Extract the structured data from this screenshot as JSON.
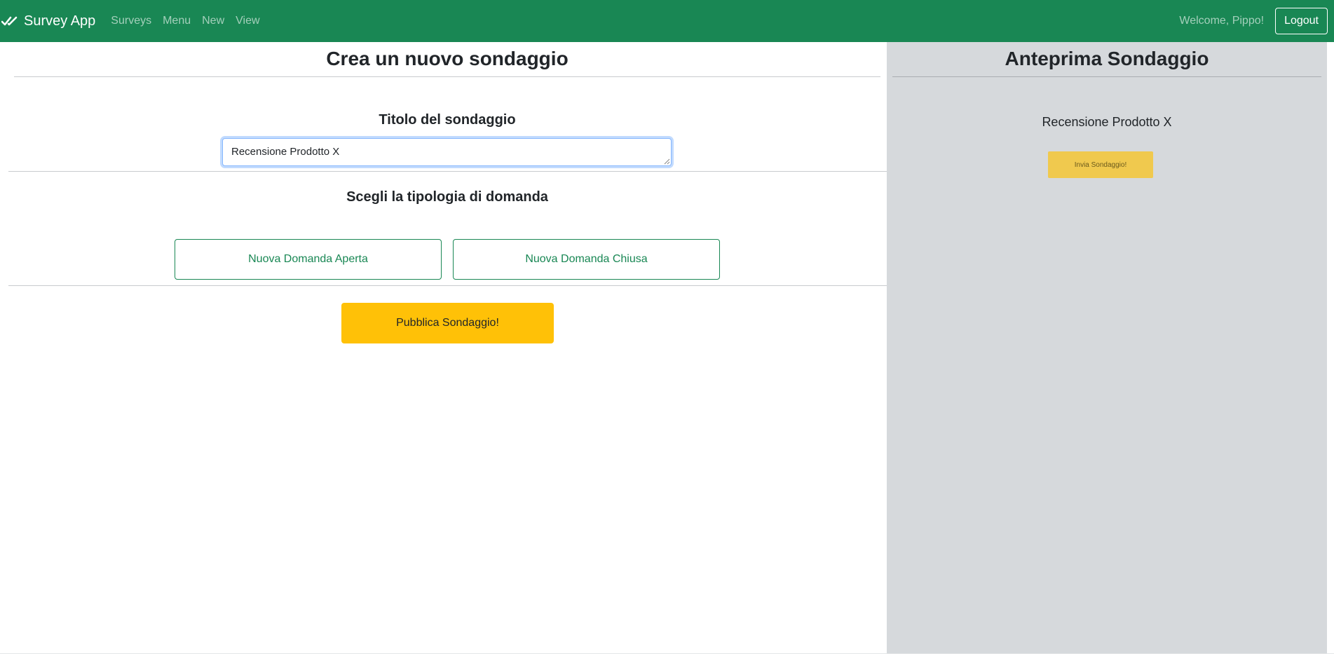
{
  "navbar": {
    "brand": "Survey App",
    "brand_icon": "double-check-icon",
    "links": [
      "Surveys",
      "Menu",
      "New",
      "View"
    ],
    "welcome": "Welcome, Pippo!",
    "logout_label": "Logout"
  },
  "editor": {
    "page_title": "Crea un nuovo sondaggio",
    "title_label": "Titolo del sondaggio",
    "title_value": "Recensione Prodotto X",
    "question_type_label": "Scegli la tipologia di domanda",
    "open_question_button": "Nuova Domanda Aperta",
    "closed_question_button": "Nuova Domanda Chiusa",
    "publish_button": "Pubblica Sondaggio!"
  },
  "preview": {
    "title": "Anteprima Sondaggio",
    "survey_title": "Recensione Prodotto X",
    "send_button": "Invia Sondaggio!"
  },
  "colors": {
    "navbar": "#198754",
    "publish": "#ffc107",
    "preview_bg": "#d6d9dc",
    "send": "#f0c94e"
  }
}
